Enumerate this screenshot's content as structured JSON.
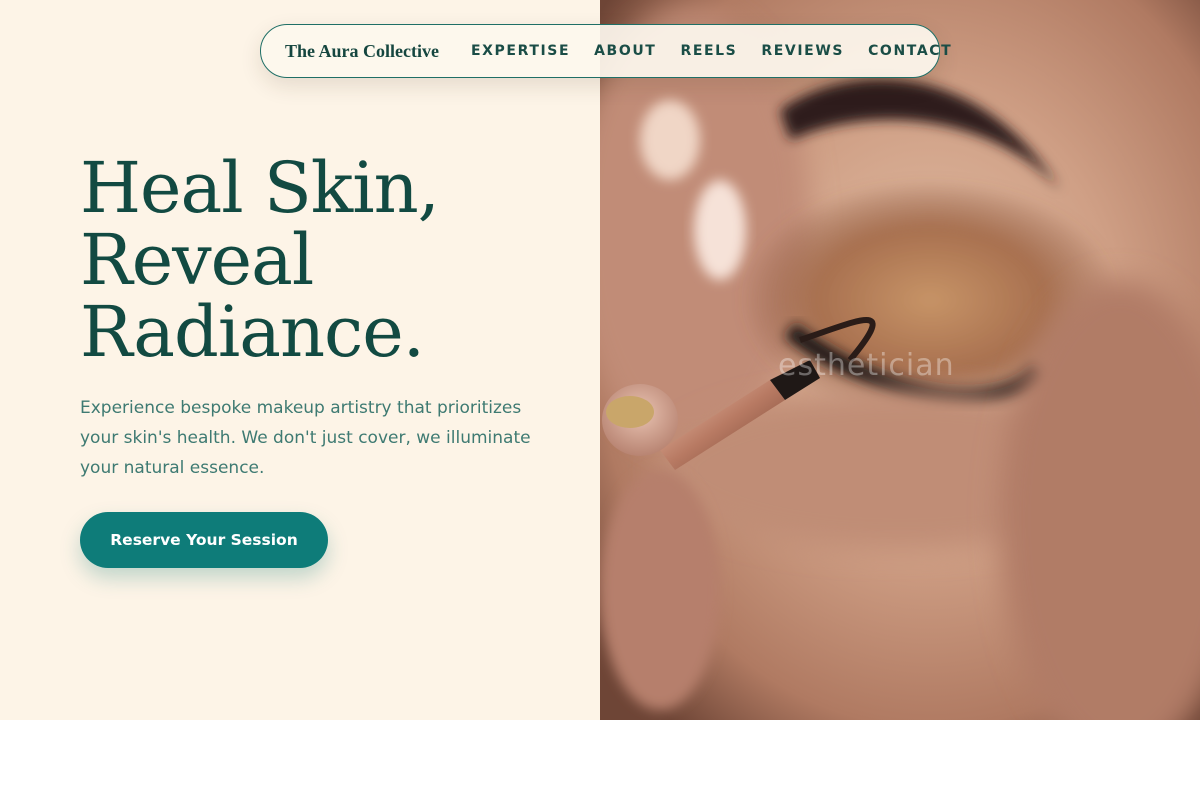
{
  "brand": {
    "name": "The Aura Collective"
  },
  "nav": {
    "links": [
      "EXPERTISE",
      "ABOUT",
      "REELS",
      "REVIEWS",
      "CONTACT"
    ]
  },
  "hero": {
    "headline": [
      "Heal Skin,",
      "Reveal",
      "Radiance."
    ],
    "subcopy": "Experience bespoke makeup artistry that prioritizes your skin's health. We don't just cover, we illuminate your natural essence.",
    "cta_label": "Reserve Your Session",
    "image": {
      "subject": "close-up of an eye receiving eyeshadow with a makeup brush",
      "watermark_text": "esthetician"
    }
  },
  "colors": {
    "accent": "#0e7c79",
    "heading": "#124a42",
    "body_text": "#3e7a72",
    "hero_bg": "#fdf4e7",
    "nav_border": "#1f6f66"
  }
}
